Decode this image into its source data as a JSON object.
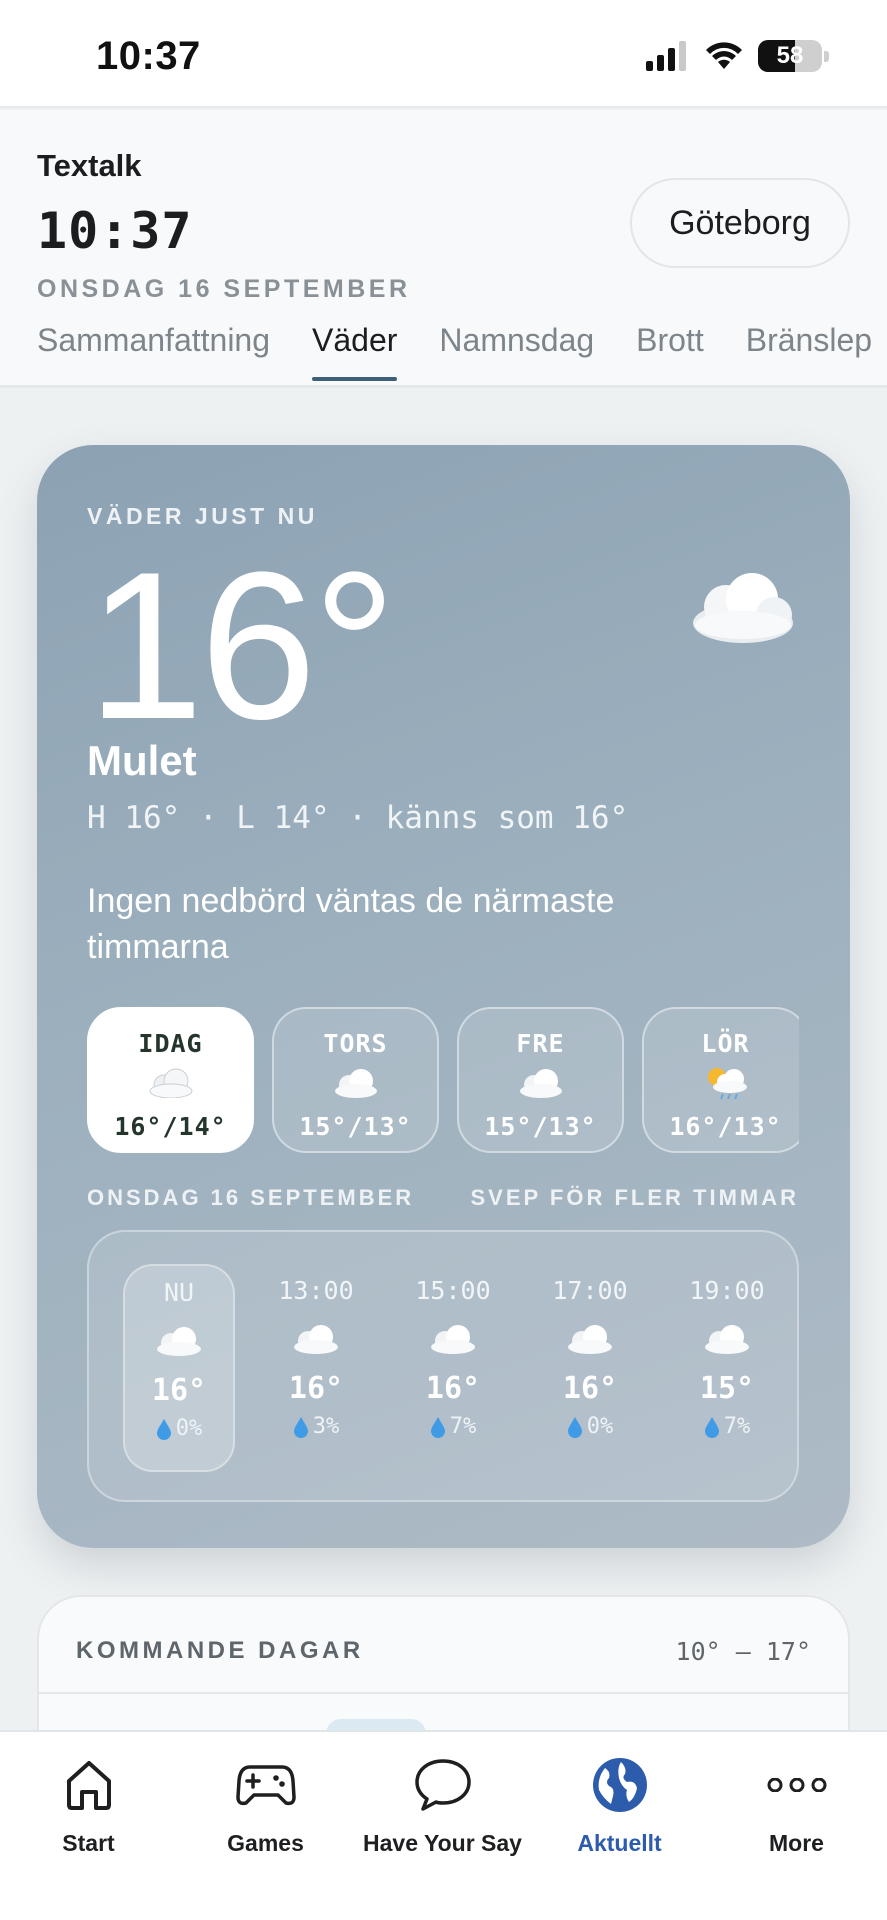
{
  "status_bar": {
    "time": "10:37",
    "battery": "58",
    "battery_level": 0.58
  },
  "header": {
    "brand": "Textalk",
    "clock": "10:37",
    "date": "ONSDAG 16 SEPTEMBER",
    "city": "Göteborg",
    "tabs": [
      "Sammanfattning",
      "Väder",
      "Namnsdag",
      "Brott",
      "Bränslep"
    ],
    "active_tab": "Väder"
  },
  "weather": {
    "section_label": "VÄDER JUST NU",
    "temperature": "16°",
    "condition": "Mulet",
    "hi_lo": "H 16° · L 14° · känns som 16°",
    "precip_note": "Ingen nedbörd väntas de närmaste timmarna",
    "icon": "cloud-icon",
    "days": [
      {
        "name": "IDAG",
        "icon": "cloud-icon",
        "range": "16°/14°",
        "active": true
      },
      {
        "name": "TORS",
        "icon": "cloud-icon",
        "range": "15°/13°"
      },
      {
        "name": "FRE",
        "icon": "cloud-icon",
        "range": "15°/13°"
      },
      {
        "name": "LÖR",
        "icon": "sun-cloud-rain-icon",
        "range": "16°/13°"
      }
    ],
    "hourly_date": "ONSDAG 16 SEPTEMBER",
    "hourly_hint": "SVEP FÖR FLER TIMMAR",
    "hours": [
      {
        "label": "NU",
        "icon": "cloud-icon",
        "temp": "16°",
        "rain": "0%"
      },
      {
        "label": "13:00",
        "icon": "cloud-icon",
        "temp": "16°",
        "rain": "3%"
      },
      {
        "label": "15:00",
        "icon": "cloud-icon",
        "temp": "16°",
        "rain": "7%"
      },
      {
        "label": "17:00",
        "icon": "cloud-icon",
        "temp": "16°",
        "rain": "0%"
      },
      {
        "label": "19:00",
        "icon": "cloud-icon",
        "temp": "15°",
        "rain": "7%"
      }
    ]
  },
  "upcoming": {
    "title": "KOMMANDE DAGAR",
    "range": "10° – 17°"
  },
  "bottom_nav": [
    {
      "label": "Start",
      "icon": "home-icon"
    },
    {
      "label": "Games",
      "icon": "gamepad-icon"
    },
    {
      "label": "Have Your Say",
      "icon": "speech-bubble-icon"
    },
    {
      "label": "Aktuellt",
      "icon": "globe-icon",
      "active": true
    },
    {
      "label": "More",
      "icon": "more-dots-icon"
    }
  ],
  "colors": {
    "accent": "#2c5cab",
    "tab_indicator": "#3e5f78",
    "card_bg": "#9db0be"
  }
}
